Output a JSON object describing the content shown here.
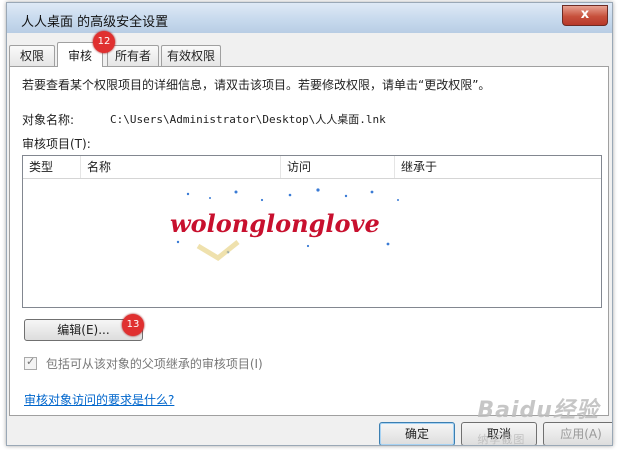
{
  "window": {
    "title": "人人桌面 的高级安全设置",
    "close_label": "x"
  },
  "tabs": [
    {
      "label": "权限"
    },
    {
      "label": "审核"
    },
    {
      "label": "所有者"
    },
    {
      "label": "有效权限"
    }
  ],
  "badges": {
    "step12": "12",
    "step13": "13"
  },
  "panel": {
    "info_text": "若要查看某个权限项目的详细信息，请双击该项目。若要修改权限，请单击“更改权限”。",
    "object_name_label": "对象名称:",
    "object_name_value": "C:\\Users\\Administrator\\Desktop\\人人桌面.lnk",
    "audit_items_label": "审核项目(T):",
    "columns": [
      "类型",
      "名称",
      "访问",
      "继承于"
    ],
    "watermark_text": "wolonglonglove",
    "edit_button": "编辑(E)...",
    "inherit_checkbox_label": "包括可从该对象的父项继承的审核项目(I)",
    "help_link": "审核对象访问的要求是什么?"
  },
  "footer": {
    "ok_label": "确定",
    "cancel_label": "取消",
    "apply_label": "应用(A)"
  },
  "site_watermark": {
    "brand": "Baidu",
    "suffix": "经验",
    "sub": "纳李截图"
  },
  "colors": {
    "accent": "#0066cc",
    "badge": "#e03030",
    "title_gradient_top": "#dfeaf6"
  }
}
